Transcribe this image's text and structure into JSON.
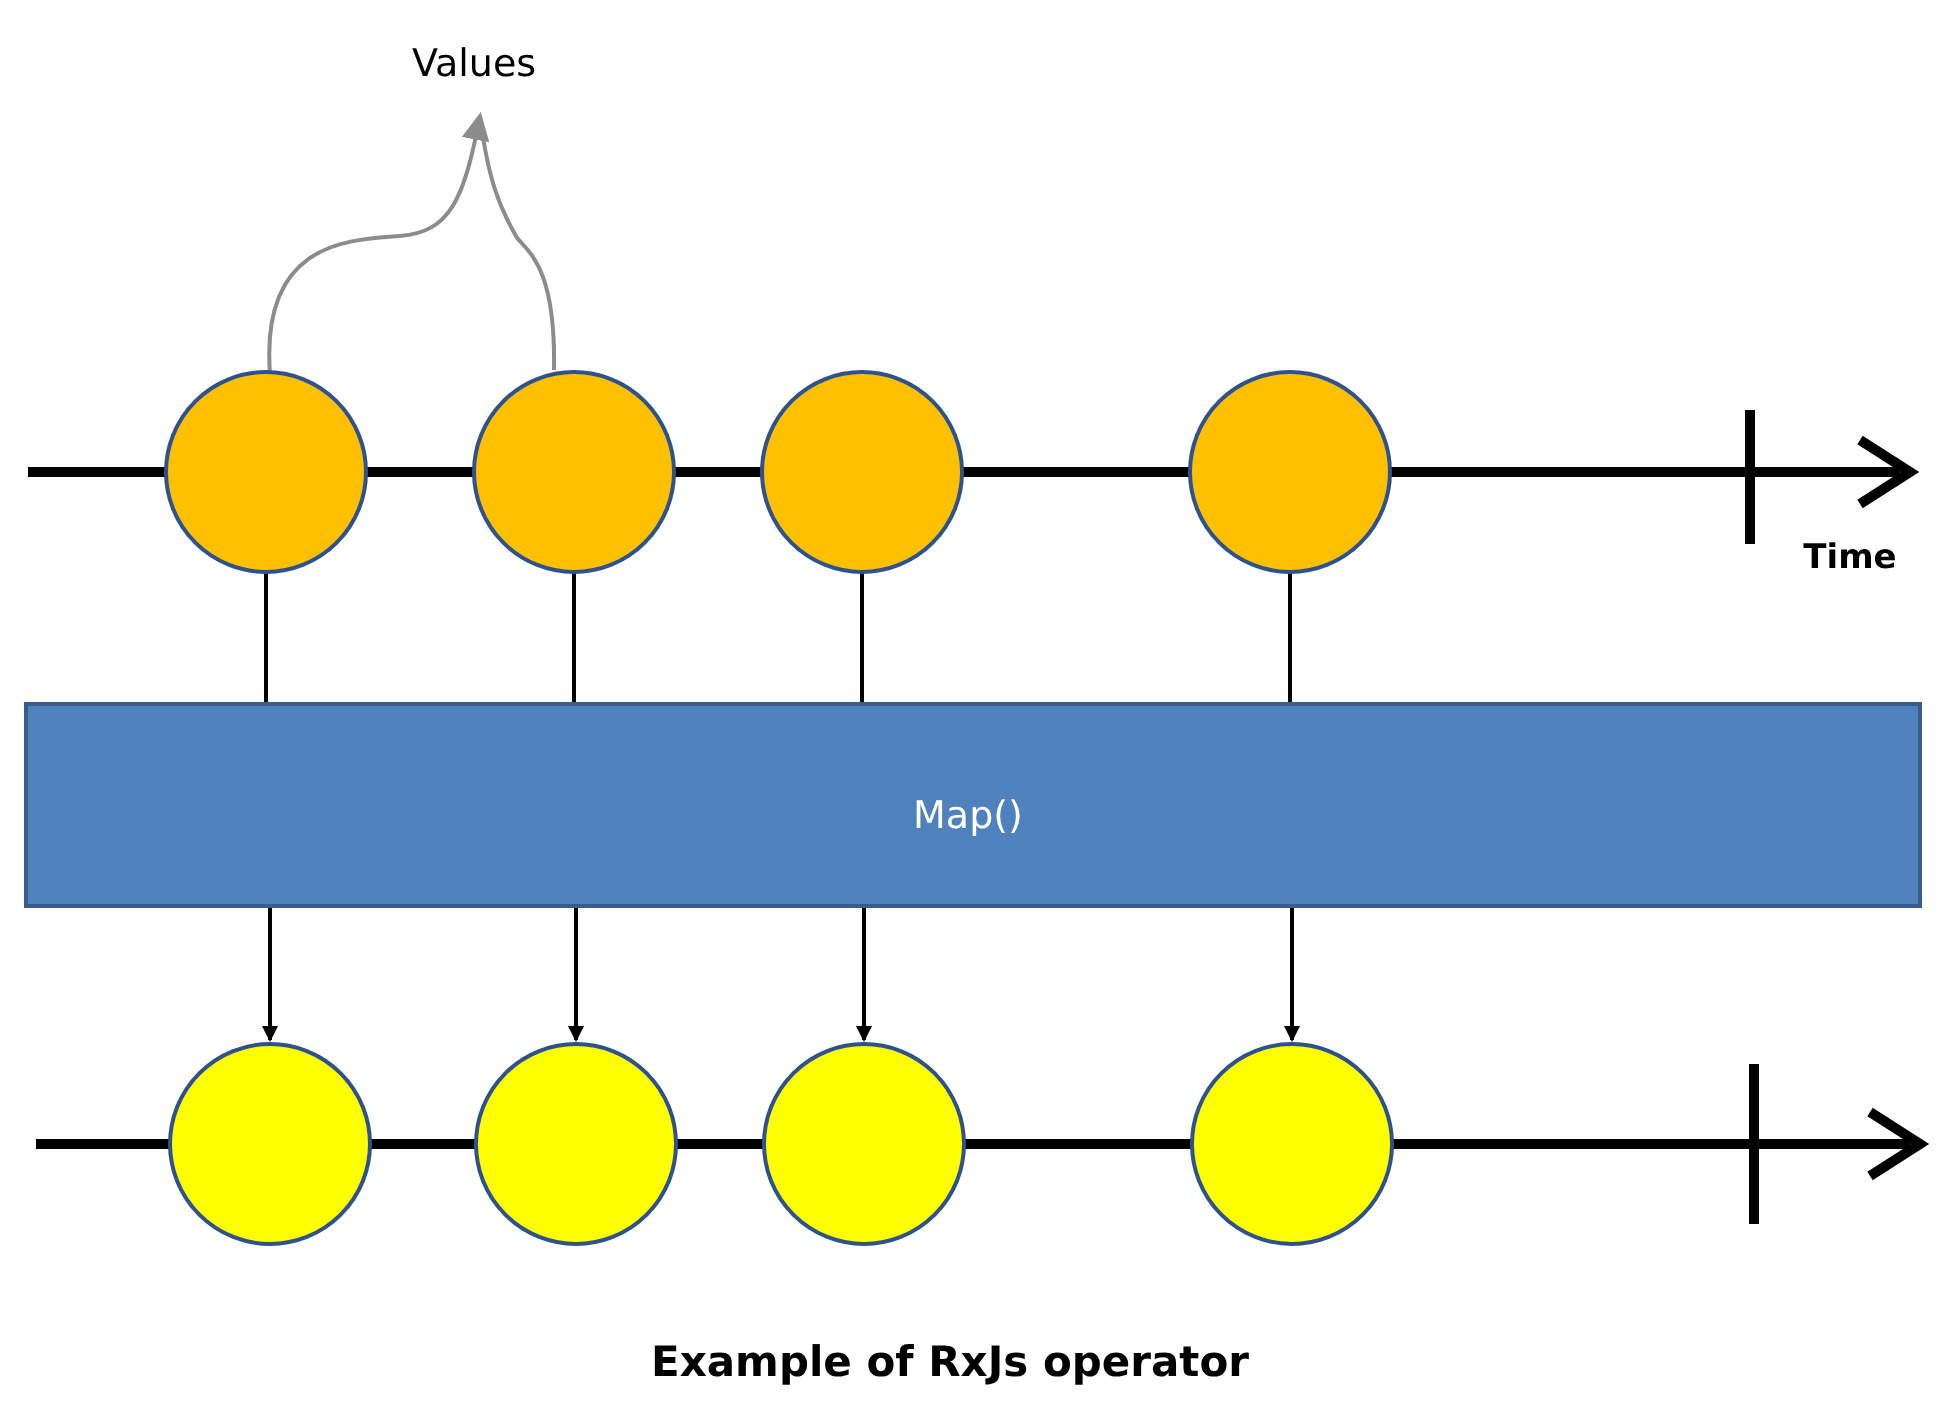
{
  "values_label": "Values",
  "time_label": "Time",
  "operator": {
    "label": "Map()"
  },
  "caption": "Example of RxJs operator"
}
